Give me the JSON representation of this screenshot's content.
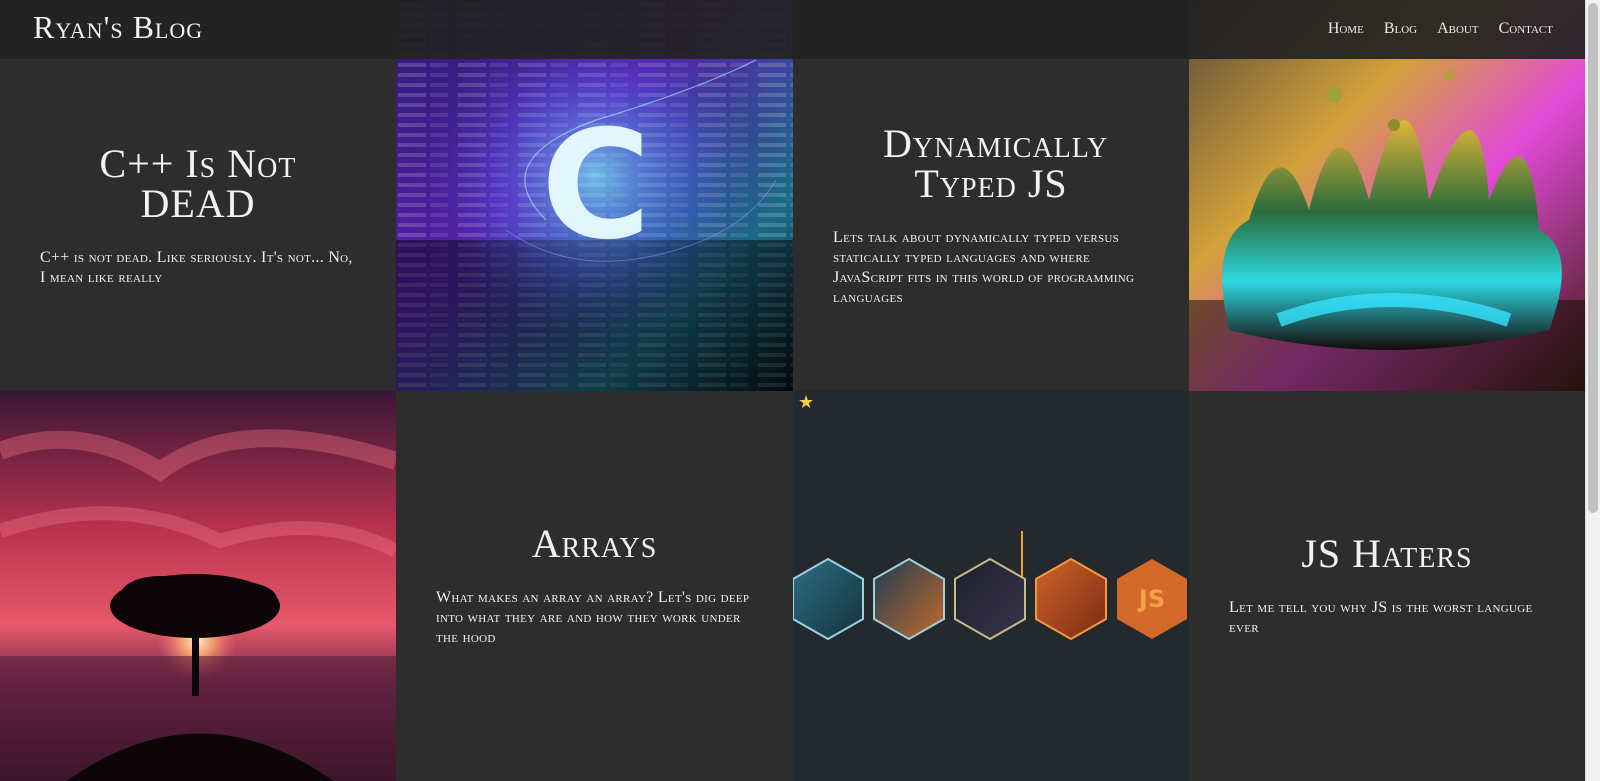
{
  "nav": {
    "brand": "Ryan's Blog",
    "links": [
      "Home",
      "Blog",
      "About",
      "Contact"
    ]
  },
  "posts": [
    {
      "title": "C++ Is Not DEAD",
      "excerpt": "C++ is not dead. Like seriously. It's not... No, I mean like really"
    },
    {
      "title": "Dynamically Typed JS",
      "excerpt": "Lets talk about dynamically typed versus statically typed languages and where JavaScript fits in this world of programming languages"
    },
    {
      "title": "Arrays",
      "excerpt": "What makes an array an array? Let's dig deep into what they are and how they work under the hood"
    },
    {
      "title": "JS Haters",
      "excerpt": "Let me tell you why JS is the worst languge ever"
    }
  ],
  "images": {
    "c_logo": {
      "icon": "c-language-logo",
      "letter": "C"
    },
    "hex_row": {
      "badge": "JS"
    }
  },
  "colors": {
    "background": "#2d2d2d",
    "navbar": "#222222",
    "text": "#f2f2f2",
    "star": "#f5d04c"
  }
}
